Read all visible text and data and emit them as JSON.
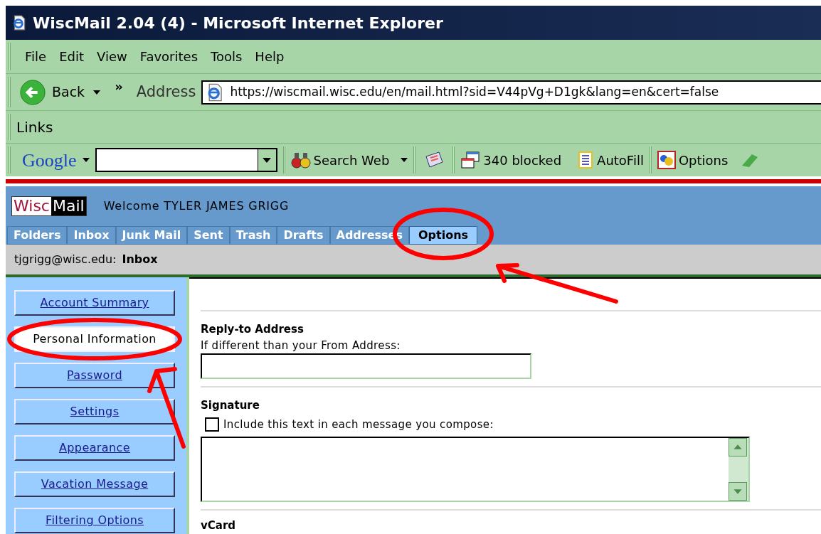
{
  "window": {
    "title": "WiscMail 2.04 (4) - Microsoft Internet Explorer"
  },
  "menu": [
    "File",
    "Edit",
    "View",
    "Favorites",
    "Tools",
    "Help"
  ],
  "nav": {
    "back": "Back",
    "more": "»",
    "address_label": "Address",
    "url": "https://wiscmail.wisc.edu/en/mail.html?sid=V44pVg+D1gk&lang=en&cert=false"
  },
  "links_bar": {
    "label": "Links"
  },
  "google_bar": {
    "logo": "Google",
    "search_web": "Search Web",
    "blocked": "340 blocked",
    "autofill": "AutoFill",
    "options": "Options"
  },
  "header": {
    "logo_left": "Wisc",
    "logo_right": "Mail",
    "welcome": "Welcome TYLER JAMES GRIGG"
  },
  "tabs": [
    {
      "label": "Folders",
      "selected": false
    },
    {
      "label": "Inbox",
      "selected": false
    },
    {
      "label": "Junk Mail",
      "selected": false
    },
    {
      "label": "Sent",
      "selected": false
    },
    {
      "label": "Trash",
      "selected": false
    },
    {
      "label": "Drafts",
      "selected": false
    },
    {
      "label": "Addresses",
      "selected": false
    },
    {
      "label": "Options",
      "selected": true
    }
  ],
  "breadcrumb": {
    "account": "tjgrigg@wisc.edu:",
    "folder": "Inbox"
  },
  "sidebar": {
    "items": [
      {
        "label": "Account Summary",
        "selected": false
      },
      {
        "label": "Personal Information",
        "selected": true
      },
      {
        "label": "Password",
        "selected": false
      },
      {
        "label": "Settings",
        "selected": false
      },
      {
        "label": "Appearance",
        "selected": false
      },
      {
        "label": "Vacation Message",
        "selected": false
      },
      {
        "label": "Filtering Options",
        "selected": false
      }
    ]
  },
  "form": {
    "reply_to": {
      "title": "Reply-to Address",
      "hint": "If different than your From Address:"
    },
    "signature": {
      "title": "Signature",
      "include_label": "Include this text in each message you compose:",
      "checked": false
    },
    "next_section": "vCard"
  }
}
